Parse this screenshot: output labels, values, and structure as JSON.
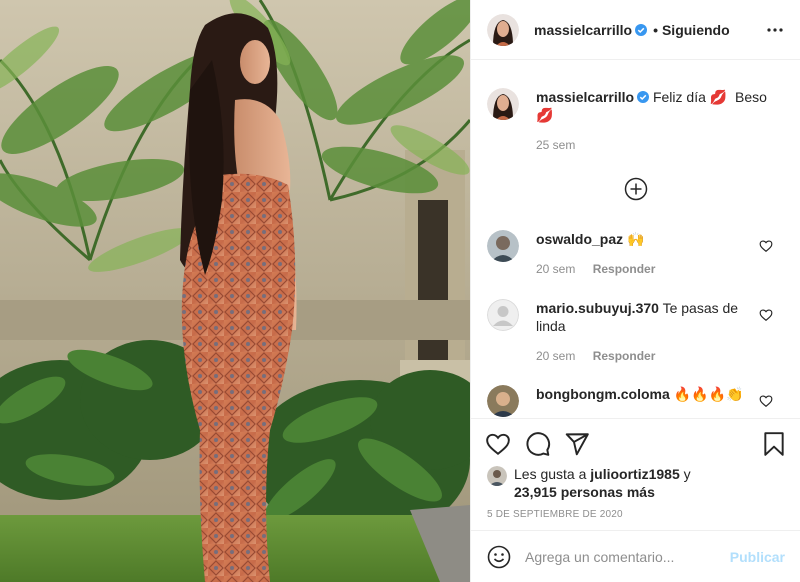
{
  "post": {
    "author": "massielcarrillo",
    "verified": true,
    "follow_status": "Siguiendo",
    "separator": "•",
    "photo_alt": "Foto de massielcarrillo"
  },
  "caption": {
    "username": "massielcarrillo",
    "text": "Feliz día",
    "emoji_1": "💋",
    "text_2": "Beso",
    "emoji_2": "💋",
    "time": "25 sem"
  },
  "comments": [
    {
      "username": "oswaldo_paz",
      "text": "🙌",
      "time": "20 sem",
      "reply": "Responder"
    },
    {
      "username": "mario.subuyuj.370",
      "text": "Te pasas de linda",
      "time": "20 sem",
      "reply": "Responder"
    },
    {
      "username": "bongbongm.coloma",
      "text": "🔥🔥🔥👏",
      "time": "",
      "reply": ""
    }
  ],
  "likes": {
    "prefix": "Les gusta a",
    "user": "julioortiz1985",
    "joiner": "y",
    "others": "23,915 personas más"
  },
  "date": "5 DE SEPTIEMBRE DE 2020",
  "add_comment": {
    "placeholder": "Agrega un comentario...",
    "publish": "Publicar"
  },
  "icons": {
    "more": "more-options-icon",
    "load_more": "plus-circle-icon",
    "like": "heart-icon",
    "comment": "comment-icon",
    "share": "paper-plane-icon",
    "save": "bookmark-icon",
    "emoji": "smiley-icon",
    "verified": "verified-badge-icon"
  },
  "colors": {
    "verified_blue": "#3897f0",
    "text": "#262626",
    "secondary": "#8e8e8e",
    "publish_disabled": "#b2dffc",
    "border": "#efefef"
  }
}
